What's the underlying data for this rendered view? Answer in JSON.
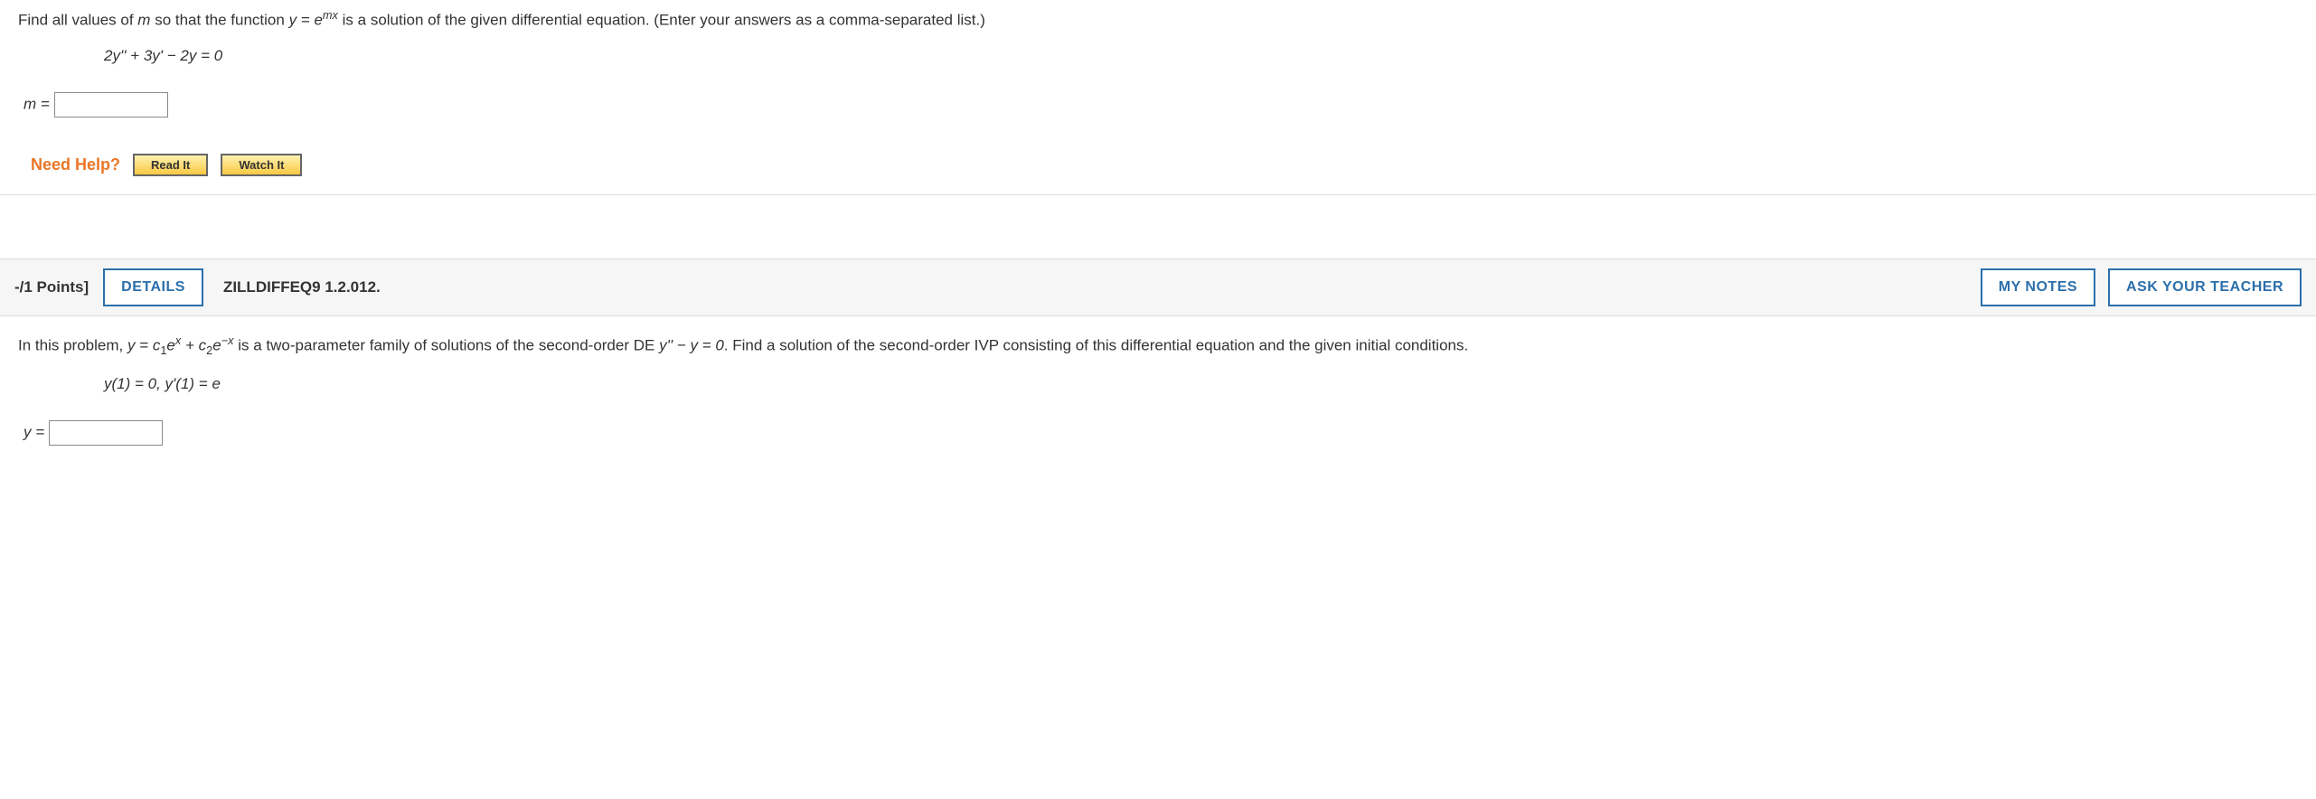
{
  "q1": {
    "prompt_pre": "Find all values of ",
    "var_m": "m",
    "prompt_mid1": " so that the function ",
    "func_eq": "y = e",
    "func_sup": "mx",
    "prompt_mid2": " is a solution of the given differential equation. (Enter your answers as a comma-separated list.)",
    "equation": "2y'' + 3y' − 2y = 0",
    "answer_label": "m = ",
    "needhelp": "Need Help?",
    "readit": "Read It",
    "watchit": "Watch It"
  },
  "q2": {
    "points": "-/1 Points]",
    "details": "DETAILS",
    "code": "ZILLDIFFEQ9 1.2.012.",
    "mynotes": "MY NOTES",
    "askteacher": "ASK YOUR TEACHER",
    "prompt_pre": "In this problem, ",
    "family_pre": "y = c",
    "c1_sub": "1",
    "e1": "e",
    "e1_sup": "x",
    "plus": " + c",
    "c2_sub": "2",
    "e2": "e",
    "e2_sup": "−x",
    "prompt_mid1": " is a two-parameter family of solutions of the second-order DE ",
    "de": "y'' − y = 0",
    "prompt_mid2": ". Find a solution of the second-order IVP consisting of this differential equation and the given initial conditions.",
    "ic": "y(1) = 0,    y'(1) = e",
    "answer_label": "y = "
  }
}
